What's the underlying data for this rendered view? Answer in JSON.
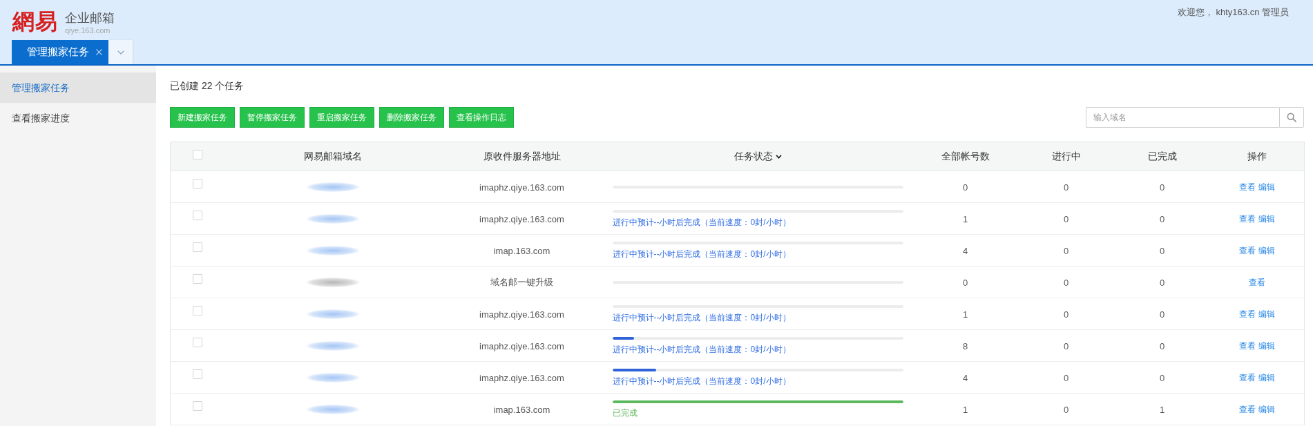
{
  "header": {
    "logo_mark": "網易",
    "product": "企业邮箱",
    "site": "qiye.163.com",
    "welcome": "欢迎您， khty163.cn 管理员"
  },
  "tabs": [
    {
      "label": "管理搬家任务",
      "selected": true
    }
  ],
  "sidebar": {
    "items": [
      {
        "label": "管理搬家任务",
        "selected": true
      },
      {
        "label": "查看搬家进度",
        "selected": false
      }
    ]
  },
  "summary": "已创建 22 个任务",
  "toolbar": {
    "buttons": [
      "新建搬家任务",
      "暂停搬家任务",
      "重启搬家任务",
      "删除搬家任务",
      "查看操作日志"
    ],
    "search": {
      "placeholder": "输入域名"
    }
  },
  "table": {
    "select_all_checked": false,
    "columns": [
      {
        "label": "网易邮箱域名",
        "dropdown": false
      },
      {
        "label": "原收件服务器地址",
        "dropdown": false
      },
      {
        "label": "任务状态",
        "dropdown": true
      },
      {
        "label": "全部帐号数",
        "dropdown": false
      },
      {
        "label": "进行中",
        "dropdown": false
      },
      {
        "label": "已完成",
        "dropdown": false
      },
      {
        "label": "操作",
        "dropdown": false
      }
    ],
    "rows": [
      {
        "checked": false,
        "domain_link": true,
        "server": "imaphz.qiye.163.com",
        "total": "0",
        "in_progress": "0",
        "completed": "0",
        "actions": [
          "查看",
          "编辑"
        ]
      },
      {
        "checked": false,
        "domain_link": true,
        "server": "imaphz.qiye.163.com",
        "status": {
          "kind": "in_progress",
          "text": "进行中预计--小时后完成（当前速度：0封/小时）"
        },
        "total": "1",
        "in_progress": "0",
        "completed": "0",
        "actions": [
          "查看",
          "编辑"
        ]
      },
      {
        "checked": false,
        "domain_link": true,
        "server": "imap.163.com",
        "status": {
          "kind": "in_progress",
          "text": "进行中预计--小时后完成（当前速度：0封/小时）"
        },
        "total": "4",
        "in_progress": "0",
        "completed": "0",
        "actions": [
          "查看",
          "编辑"
        ]
      },
      {
        "checked": false,
        "domain_link": false,
        "server": "域名邮一键升级",
        "total": "0",
        "in_progress": "0",
        "completed": "0",
        "actions": [
          "查看"
        ]
      },
      {
        "checked": false,
        "domain_link": true,
        "server": "imaphz.qiye.163.com",
        "status": {
          "kind": "in_progress",
          "text": "进行中预计--小时后完成（当前速度：0封/小时）"
        },
        "total": "1",
        "in_progress": "0",
        "completed": "0",
        "actions": [
          "查看",
          "编辑"
        ]
      },
      {
        "checked": false,
        "domain_link": true,
        "server": "imaphz.qiye.163.com",
        "status": {
          "kind": "in_progress",
          "level": 0.074,
          "text": "进行中预计--小时后完成（当前速度：0封/小时）"
        },
        "total": "8",
        "in_progress": "0",
        "completed": "0",
        "actions": [
          "查看",
          "编辑"
        ]
      },
      {
        "checked": false,
        "domain_link": true,
        "server": "imaphz.qiye.163.com",
        "status": {
          "kind": "in_progress",
          "level": 0.15,
          "text": "进行中预计--小时后完成（当前速度：0封/小时）"
        },
        "total": "4",
        "in_progress": "0",
        "completed": "0",
        "actions": [
          "查看",
          "编辑"
        ]
      },
      {
        "checked": false,
        "domain_link": true,
        "server": "imap.163.com",
        "status": {
          "kind": "done",
          "level": 1,
          "text": "已完成"
        },
        "total": "1",
        "in_progress": "0",
        "completed": "1",
        "actions": [
          "查看",
          "编辑"
        ]
      }
    ]
  }
}
